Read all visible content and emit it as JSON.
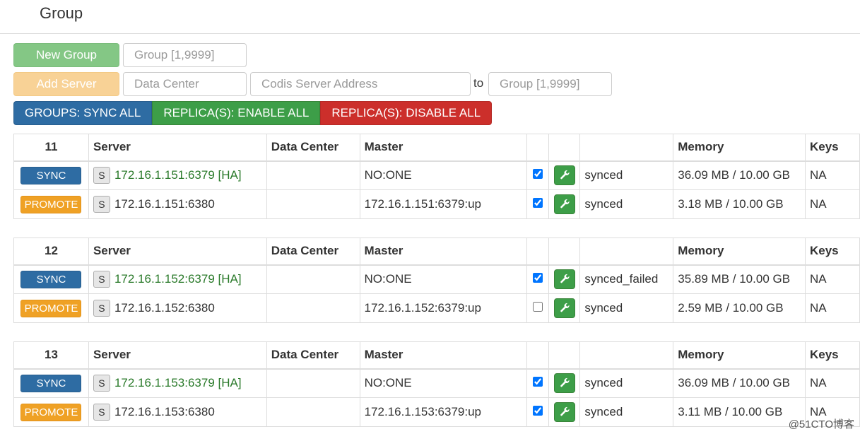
{
  "header": {
    "title": "Group"
  },
  "toolbar": {
    "new_group_label": "New Group",
    "group_placeholder": "Group [1,9999]",
    "add_server_label": "Add Server",
    "data_center_placeholder": "Data Center",
    "server_address_placeholder": "Codis Server Address",
    "to_label": "to",
    "target_group_placeholder": "Group [1,9999]"
  },
  "bulk_actions": {
    "sync_all": "GROUPS: SYNC ALL",
    "enable_all": "REPLICA(S): ENABLE ALL",
    "disable_all": "REPLICA(S): DISABLE ALL"
  },
  "columns": {
    "server": "Server",
    "data_center": "Data Center",
    "master": "Master",
    "memory": "Memory",
    "keys": "Keys"
  },
  "groups": [
    {
      "id": "11",
      "rows": [
        {
          "action": "SYNC",
          "s": "S",
          "server": "172.16.1.151:6379 [HA]",
          "ha": true,
          "data_center": "",
          "master": "NO:ONE",
          "checked": true,
          "status": "synced",
          "memory": "36.09 MB / 10.00 GB",
          "keys": "NA"
        },
        {
          "action": "PROMOTE",
          "s": "S",
          "server": "172.16.1.151:6380",
          "ha": false,
          "data_center": "",
          "master": "172.16.1.151:6379:up",
          "checked": true,
          "status": "synced",
          "memory": "3.18 MB / 10.00 GB",
          "keys": "NA"
        }
      ]
    },
    {
      "id": "12",
      "rows": [
        {
          "action": "SYNC",
          "s": "S",
          "server": "172.16.1.152:6379 [HA]",
          "ha": true,
          "data_center": "",
          "master": "NO:ONE",
          "checked": true,
          "status": "synced_failed",
          "memory": "35.89 MB / 10.00 GB",
          "keys": "NA"
        },
        {
          "action": "PROMOTE",
          "s": "S",
          "server": "172.16.1.152:6380",
          "ha": false,
          "data_center": "",
          "master": "172.16.1.152:6379:up",
          "checked": false,
          "status": "synced",
          "memory": "2.59 MB / 10.00 GB",
          "keys": "NA"
        }
      ]
    },
    {
      "id": "13",
      "rows": [
        {
          "action": "SYNC",
          "s": "S",
          "server": "172.16.1.153:6379 [HA]",
          "ha": true,
          "data_center": "",
          "master": "NO:ONE",
          "checked": true,
          "status": "synced",
          "memory": "36.09 MB / 10.00 GB",
          "keys": "NA"
        },
        {
          "action": "PROMOTE",
          "s": "S",
          "server": "172.16.1.153:6380",
          "ha": false,
          "data_center": "",
          "master": "172.16.1.153:6379:up",
          "checked": true,
          "status": "synced",
          "memory": "3.11 MB / 10.00 GB",
          "keys": "NA"
        }
      ]
    }
  ],
  "watermark": "@51CTO博客",
  "icons": {
    "config": "wrench-icon"
  },
  "colors": {
    "sync": "#2e6ca3",
    "promote": "#efa125",
    "enable": "#3d9e48",
    "disable": "#cc2f2b",
    "ha_text": "#2a7a2a"
  }
}
